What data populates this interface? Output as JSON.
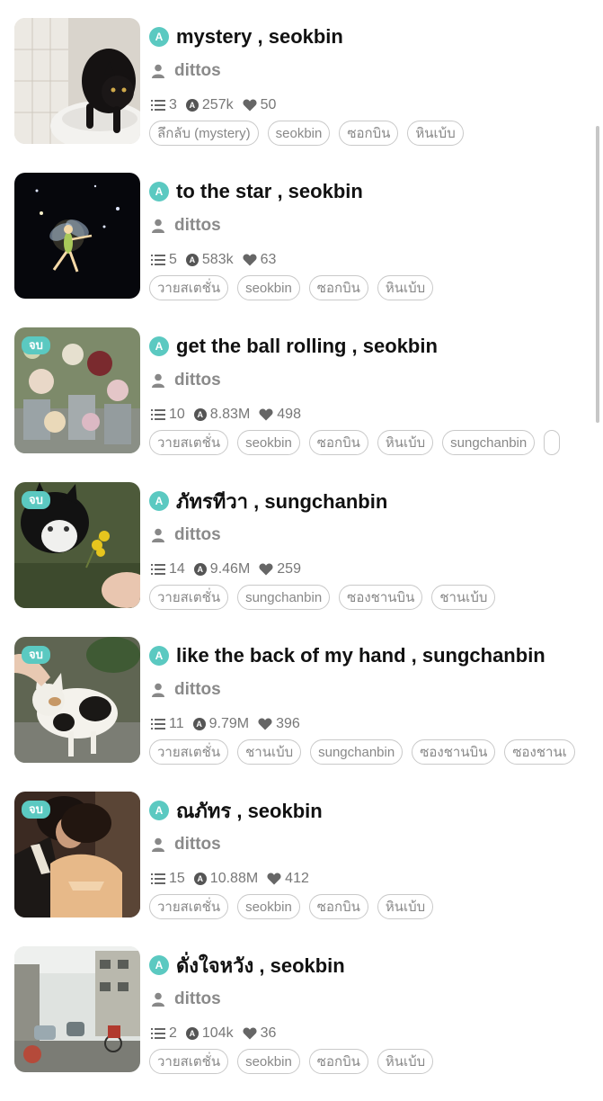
{
  "colors": {
    "accent": "#5bc9c1",
    "tag_border": "#c9c9c9",
    "meta_text": "#8a8a8a"
  },
  "stories": [
    {
      "title": "mystery , seokbin",
      "author": "dittos",
      "chapters": "3",
      "views": "257k",
      "likes": "50",
      "completed": false,
      "badge": "",
      "thumb": "black-cat-on-toilet",
      "tags": [
        "ลึกลับ (mystery)",
        "seokbin",
        "ซอกบิน",
        "หินเบ้บ"
      ]
    },
    {
      "title": "to the star , seokbin",
      "author": "dittos",
      "chapters": "5",
      "views": "583k",
      "likes": "63",
      "completed": false,
      "badge": "",
      "thumb": "fairy-in-night-sky",
      "tags": [
        "วายสเตชั่น",
        "seokbin",
        "ซอกบิน",
        "หินเบ้บ"
      ]
    },
    {
      "title": "get the ball rolling , seokbin",
      "author": "dittos",
      "chapters": "10",
      "views": "8.83M",
      "likes": "498",
      "completed": true,
      "badge": "จบ",
      "thumb": "flower-bouquets",
      "tags": [
        "วายสเตชั่น",
        "seokbin",
        "ซอกบิน",
        "หินเบ้บ",
        "sungchanbin",
        ""
      ]
    },
    {
      "title": "ภัทรทีวา , sungchanbin",
      "author": "dittos",
      "chapters": "14",
      "views": "9.46M",
      "likes": "259",
      "completed": true,
      "badge": "จบ",
      "thumb": "cat-and-yellow-flowers",
      "tags": [
        "วายสเตชั่น",
        "sungchanbin",
        "ซองชานบิน",
        "ชานเบ้บ"
      ]
    },
    {
      "title": "like the back of my hand , sungchanbin",
      "author": "dittos",
      "chapters": "11",
      "views": "9.79M",
      "likes": "396",
      "completed": true,
      "badge": "จบ",
      "thumb": "hand-petting-cat",
      "tags": [
        "วายสเตชั่น",
        "ชานเบ้บ",
        "sungchanbin",
        "ซองชานบิน",
        "ซองชานเ"
      ]
    },
    {
      "title": "ณภัทร , seokbin",
      "author": "dittos",
      "chapters": "15",
      "views": "10.88M",
      "likes": "412",
      "completed": true,
      "badge": "จบ",
      "thumb": "couple-embrace",
      "tags": [
        "วายสเตชั่น",
        "seokbin",
        "ซอกบิน",
        "หินเบ้บ"
      ]
    },
    {
      "title": "ดั่งใจหวัง , seokbin",
      "author": "dittos",
      "chapters": "2",
      "views": "104k",
      "likes": "36",
      "completed": false,
      "badge": "",
      "thumb": "vintage-street",
      "tags": [
        "วายสเตชั่น",
        "seokbin",
        "ซอกบิน",
        "หินเบ้บ"
      ]
    }
  ]
}
